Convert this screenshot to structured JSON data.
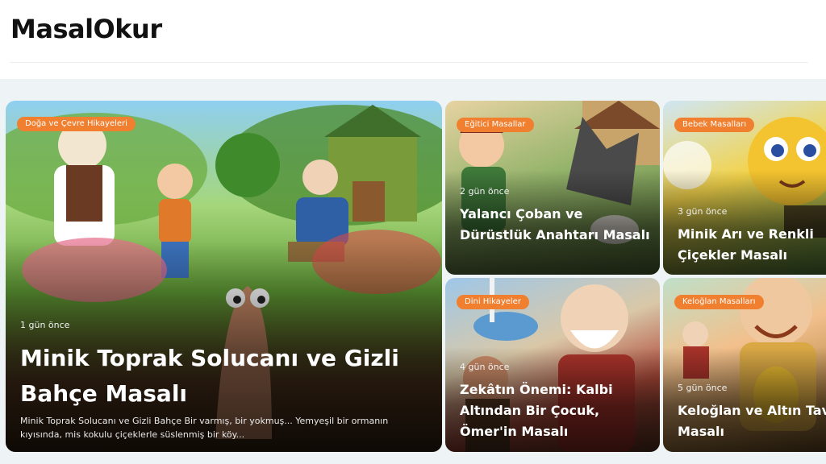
{
  "site": {
    "logo": "MasalOkur"
  },
  "featured": {
    "category": "Doğa ve Çevre Hikayeleri",
    "time": "1 gün önce",
    "title": "Minik Toprak Solucanı ve Gizli Bahçe Masalı",
    "excerpt": "Minik Toprak Solucanı ve Gizli Bahçe Bir varmış, bir yokmuş... Yemyeşil bir ormanın kıyısında, mis kokulu çiçeklerle süslenmiş bir köy..."
  },
  "cards": [
    {
      "category": "Eğitici Masallar",
      "time": "2 gün önce",
      "title": "Yalancı Çoban ve Dürüstlük Anahtarı Masalı"
    },
    {
      "category": "Bebek Masalları",
      "time": "3 gün önce",
      "title": "Minik Arı ve Renkli Çiçekler Masalı"
    },
    {
      "category": "Dini Hikayeler",
      "time": "4 gün önce",
      "title": "Zekâtın Önemi: Kalbi Altından Bir Çocuk, Ömer'in Masalı"
    },
    {
      "category": "Keloğlan Masalları",
      "time": "5 gün önce",
      "title": "Keloğlan ve Altın Tavuk Masalı"
    }
  ]
}
